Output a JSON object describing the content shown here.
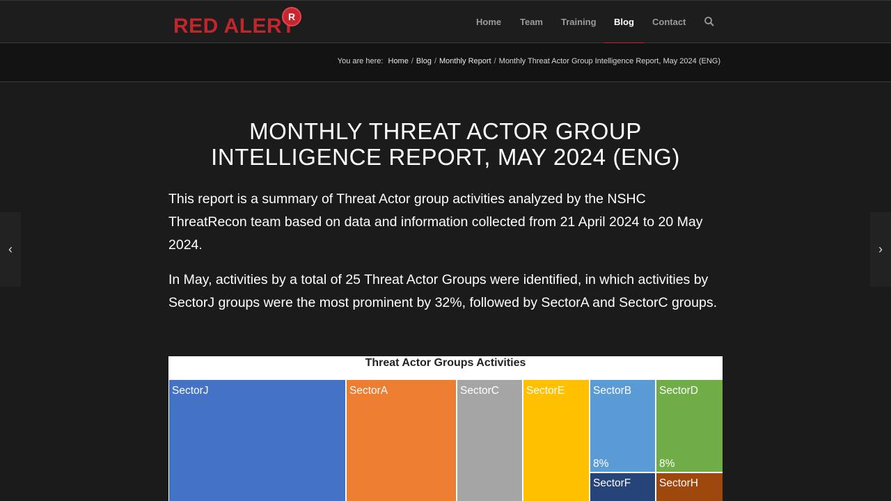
{
  "brand": {
    "name": "Red Alert",
    "badge": "R"
  },
  "nav": {
    "items": [
      {
        "label": "Home"
      },
      {
        "label": "Team"
      },
      {
        "label": "Training"
      },
      {
        "label": "Blog",
        "active": true
      },
      {
        "label": "Contact"
      }
    ],
    "search_icon": "search-icon"
  },
  "breadcrumb": {
    "prefix": "You are here:",
    "items": [
      "Home",
      "Blog",
      "Monthly Report",
      "Monthly Threat Actor Group Intelligence Report, May 2024 (ENG)"
    ]
  },
  "article": {
    "title_line1": "MONTHLY THREAT ACTOR GROUP",
    "title_line2": "INTELLIGENCE REPORT, MAY 2024 (ENG)",
    "paragraph1": "This report is a summary of Threat Actor group activities analyzed by the NSHC ThreatRecon team based on data and information collected from 21 April 2024 to 20 May 2024.",
    "paragraph2": "In May, activities by a total of 25 Threat Actor Groups were identified, in which activities by SectorJ groups were the most prominent by 32%, followed by SectorA and SectorC groups."
  },
  "side_arrows": {
    "prev": "chevron-left-icon",
    "next": "chevron-right-icon"
  },
  "chart_data": {
    "type": "treemap",
    "title": "Threat Actor Groups Activities",
    "tiles": [
      {
        "name": "SectorJ",
        "color": "#4472c4"
      },
      {
        "name": "SectorA",
        "color": "#ed7d31"
      },
      {
        "name": "SectorC",
        "color": "#a5a5a5"
      },
      {
        "name": "SectorE",
        "color": "#ffc000"
      },
      {
        "name": "SectorB",
        "value": "8%",
        "color": "#5b9bd5"
      },
      {
        "name": "SectorD",
        "value": "8%",
        "color": "#70ad47"
      },
      {
        "name": "SectorF",
        "color": "#264478"
      },
      {
        "name": "SectorH",
        "color": "#9e480e"
      }
    ]
  }
}
